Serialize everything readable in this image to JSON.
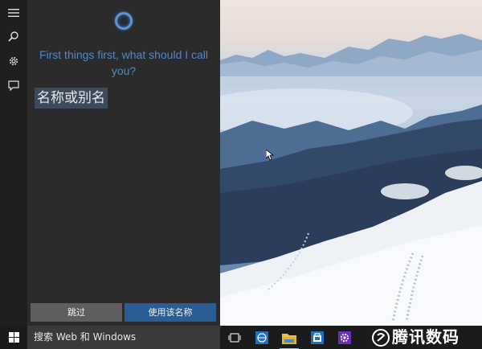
{
  "cortana": {
    "prompt": "First things first, what should I call you?",
    "name_value": "名称或别名",
    "skip_label": "跳过",
    "use_name_label": "使用该名称"
  },
  "taskbar": {
    "search_placeholder": "搜索 Web 和 Windows",
    "icons": [
      "task-view",
      "edge",
      "file-explorer",
      "store",
      "settings"
    ]
  },
  "watermark": {
    "text": "腾讯数码"
  },
  "colors": {
    "accent": "#4e88c7",
    "primary_button": "#2a5c95",
    "secondary_button": "#5e5e5e",
    "panel": "#2b2b2b",
    "taskbar": "#1b1b1b"
  }
}
